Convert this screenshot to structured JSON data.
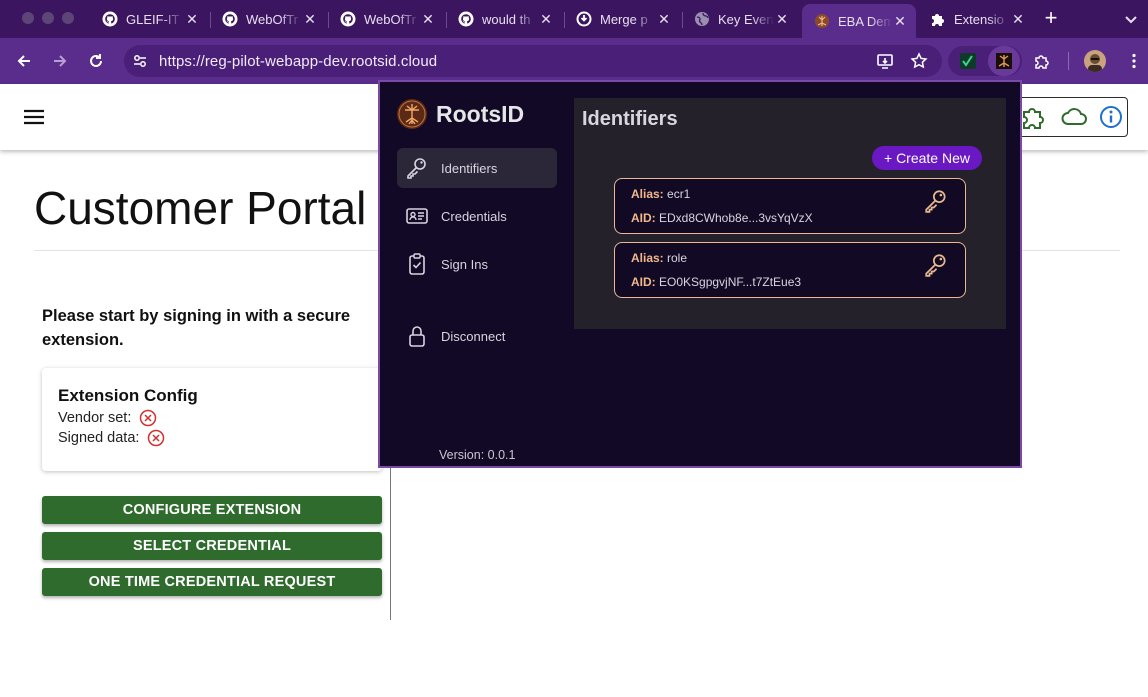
{
  "browser": {
    "tabs": [
      {
        "title": "GLEIF-IT",
        "icon": "github-icon"
      },
      {
        "title": "WebOfTr",
        "icon": "github-icon"
      },
      {
        "title": "WebOfTr",
        "icon": "github-icon"
      },
      {
        "title": "would th",
        "icon": "github-icon"
      },
      {
        "title": "Merge p",
        "icon": "github-merge-icon"
      },
      {
        "title": "Key Even",
        "icon": "globe-icon"
      },
      {
        "title": "EBA Dem",
        "icon": "rootsid-icon",
        "active": true
      },
      {
        "title": "Extensio",
        "icon": "puzzle-icon"
      }
    ],
    "url": "https://reg-pilot-webapp-dev.rootsid.cloud"
  },
  "page": {
    "title": "Customer Portal",
    "intro": "Please start by signing in with a secure extension.",
    "config_card": {
      "title": "Extension Config",
      "vendor_label": "Vendor set:",
      "signed_label": "Signed data:"
    },
    "buttons": {
      "configure": "CONFIGURE EXTENSION",
      "select": "SELECT CREDENTIAL",
      "one_time": "ONE TIME CREDENTIAL REQUEST"
    }
  },
  "popup": {
    "brand": "RootsID",
    "nav": {
      "identifiers": "Identifiers",
      "credentials": "Credentials",
      "sign_ins": "Sign Ins",
      "disconnect": "Disconnect"
    },
    "version": "Version: 0.0.1",
    "panel_title": "Identifiers",
    "create_new": "+ Create New",
    "alias_label": "Alias:",
    "aid_label": "AID:",
    "identifiers": [
      {
        "alias": "ecr1",
        "aid": "EDxd8CWhob8e...3vsYqVzX"
      },
      {
        "alias": "role",
        "aid": "EO0KSgpgvjNF...t7ZtEue3"
      }
    ]
  },
  "colors": {
    "tab_strip": "#3b1560",
    "toolbar": "#5a2d8c",
    "action_button": "#2e6b2c",
    "popup_bg": "#110925",
    "accent_purple": "#6a18c4",
    "card_border": "#e8b890",
    "error_red": "#d32f2f"
  }
}
